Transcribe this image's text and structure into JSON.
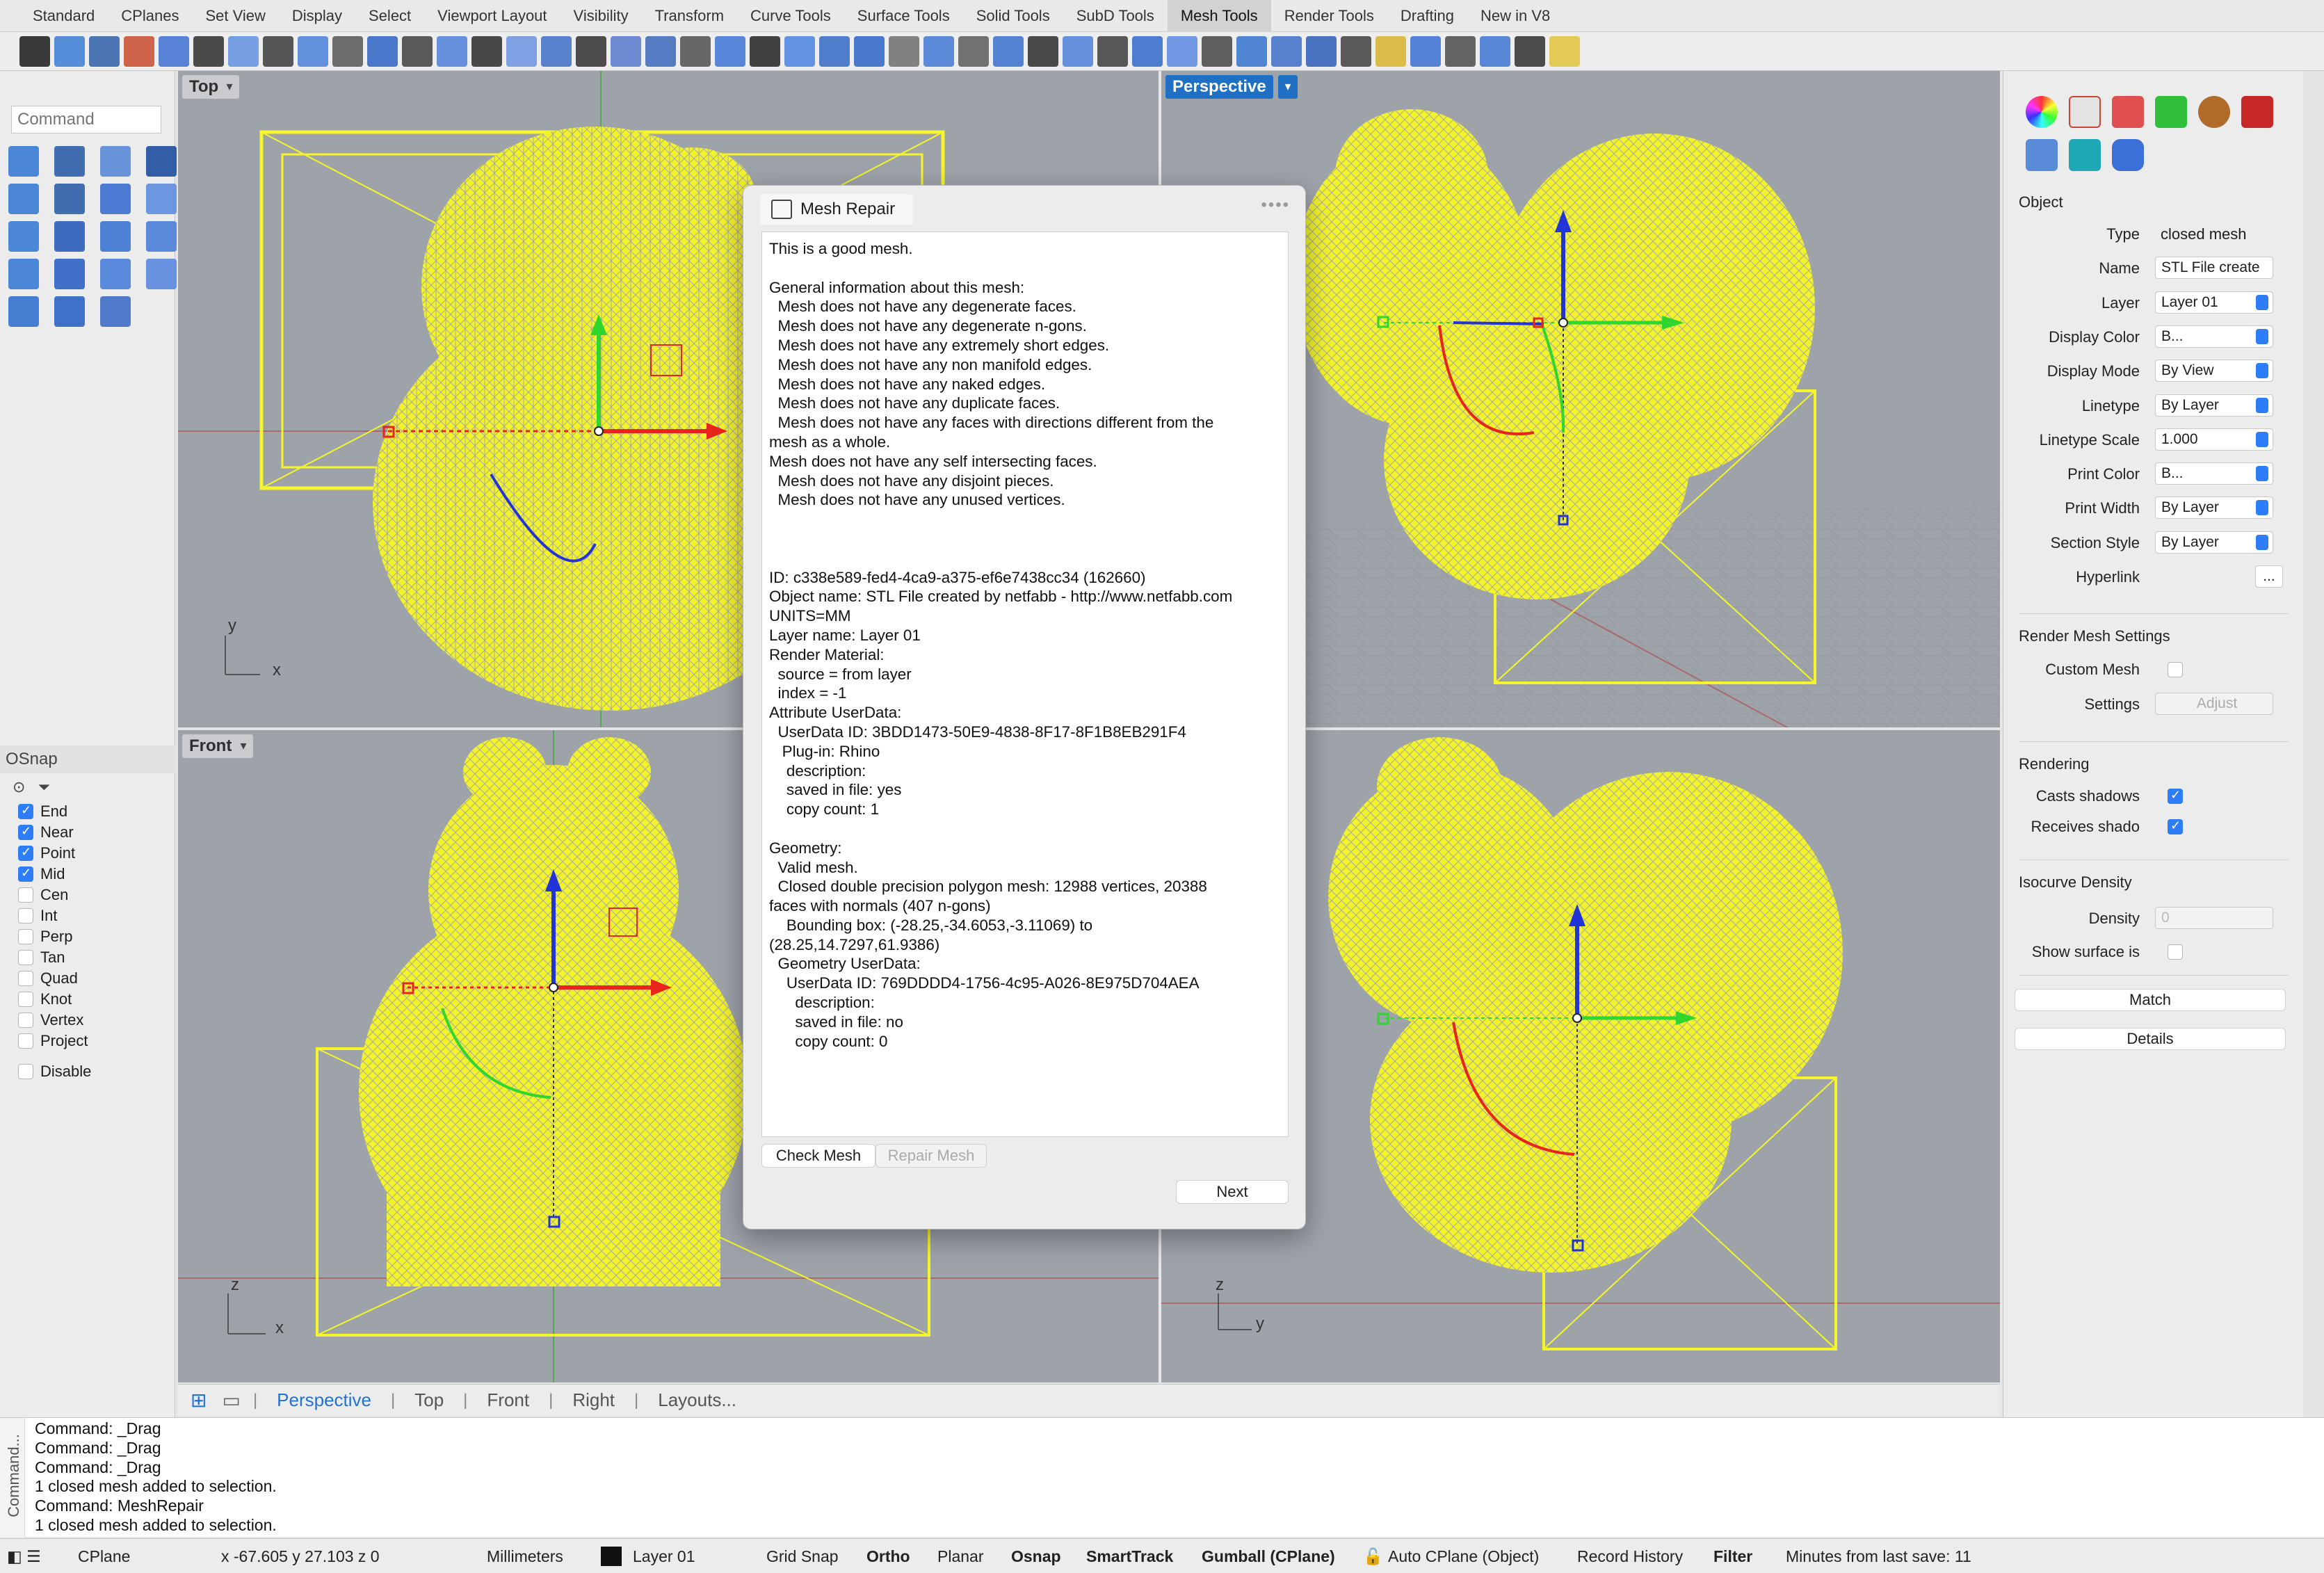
{
  "tabs": [
    "Standard",
    "CPlanes",
    "Set View",
    "Display",
    "Select",
    "Viewport Layout",
    "Visibility",
    "Transform",
    "Curve Tools",
    "Surface Tools",
    "Solid Tools",
    "SubD Tools",
    "Mesh Tools",
    "Render Tools",
    "Drafting",
    "New in V8"
  ],
  "active_tab": "Mesh Tools",
  "command_placeholder": "Command",
  "osnap": {
    "title": "OSnap",
    "items": [
      {
        "label": "End",
        "checked": true
      },
      {
        "label": "Near",
        "checked": true
      },
      {
        "label": "Point",
        "checked": true
      },
      {
        "label": "Mid",
        "checked": true
      },
      {
        "label": "Cen",
        "checked": false
      },
      {
        "label": "Int",
        "checked": false
      },
      {
        "label": "Perp",
        "checked": false
      },
      {
        "label": "Tan",
        "checked": false
      },
      {
        "label": "Quad",
        "checked": false
      },
      {
        "label": "Knot",
        "checked": false
      },
      {
        "label": "Vertex",
        "checked": false
      },
      {
        "label": "Project",
        "checked": false
      }
    ],
    "disable_label": "Disable"
  },
  "viewports": {
    "top": {
      "title": "Top",
      "axes": [
        "y",
        "x"
      ]
    },
    "perspective": {
      "title": "Perspective"
    },
    "front": {
      "title": "Front",
      "axes": [
        "z",
        "x"
      ]
    },
    "right": {
      "axes": [
        "z",
        "y"
      ]
    }
  },
  "viewport_tabs": [
    "Perspective",
    "Top",
    "Front",
    "Right",
    "Layouts..."
  ],
  "active_viewport_tab": "Perspective",
  "dialog": {
    "title": "Mesh Repair",
    "lines": [
      "This is a good mesh.",
      "",
      "General information about this mesh:",
      "  Mesh does not have any degenerate faces.",
      "  Mesh does not have any degenerate n-gons.",
      "  Mesh does not have any extremely short edges.",
      "  Mesh does not have any non manifold edges.",
      "  Mesh does not have any naked edges.",
      "  Mesh does not have any duplicate faces.",
      "  Mesh does not have any faces with directions different from the",
      "mesh as a whole.",
      "Mesh does not have any self intersecting faces.",
      "  Mesh does not have any disjoint pieces.",
      "  Mesh does not have any unused vertices.",
      "",
      "",
      "",
      "ID: c338e589-fed4-4ca9-a375-ef6e7438cc34 (162660)",
      "Object name: STL File created by netfabb - http://www.netfabb.com",
      "UNITS=MM",
      "Layer name: Layer 01",
      "Render Material:",
      "  source = from layer",
      "  index = -1",
      "Attribute UserData:",
      "  UserData ID: 3BDD1473-50E9-4838-8F17-8F1B8EB291F4",
      "   Plug-in: Rhino",
      "    description:",
      "    saved in file: yes",
      "    copy count: 1",
      "",
      "Geometry:",
      "  Valid mesh.",
      "  Closed double precision polygon mesh: 12988 vertices, 20388",
      "faces with normals (407 n-gons)",
      "    Bounding box: (-28.25,-34.6053,-3.11069) to",
      "(28.25,14.7297,61.9386)",
      "  Geometry UserData:",
      "    UserData ID: 769DDDD4-1756-4c95-A026-8E975D704AEA",
      "      description:",
      "      saved in file: no",
      "      copy count: 0"
    ],
    "check_mesh": "Check Mesh",
    "repair_mesh": "Repair Mesh",
    "next": "Next"
  },
  "properties": {
    "section_object": "Object",
    "rows": [
      {
        "label": "Type",
        "value": "closed mesh",
        "kind": "plain"
      },
      {
        "label": "Name",
        "value": "STL File create",
        "kind": "field"
      },
      {
        "label": "Layer",
        "value": "Layer 01",
        "kind": "select"
      },
      {
        "label": "Display Color",
        "value": "B...",
        "kind": "select"
      },
      {
        "label": "Display Mode",
        "value": "By View",
        "kind": "select"
      },
      {
        "label": "Linetype",
        "value": "By Layer",
        "kind": "select"
      },
      {
        "label": "Linetype Scale",
        "value": "1.000",
        "kind": "spin"
      },
      {
        "label": "Print Color",
        "value": "B...",
        "kind": "select"
      },
      {
        "label": "Print Width",
        "value": "By Layer",
        "kind": "select"
      },
      {
        "label": "Section Style",
        "value": "By Layer",
        "kind": "select"
      },
      {
        "label": "Hyperlink",
        "value": "...",
        "kind": "button"
      }
    ],
    "render_mesh_settings": "Render Mesh Settings",
    "custom_mesh": "Custom Mesh",
    "settings": "Settings",
    "adjust": "Adjust",
    "rendering": "Rendering",
    "casts_shadows": "Casts shadows",
    "receives_shadows": "Receives shado",
    "isocurve_density": "Isocurve Density",
    "density": "Density",
    "density_value": "0",
    "show_surface": "Show surface is",
    "match": "Match",
    "details": "Details"
  },
  "command_history": [
    "Command: _Drag",
    "Command: _Drag",
    "Command: _Drag",
    "1 closed mesh added to selection.",
    "Command: MeshRepair",
    "1 closed mesh added to selection."
  ],
  "command_side_label": "Command...",
  "status": {
    "cplane": "CPlane",
    "coords": "x -67.605  y 27.103  z 0",
    "units": "Millimeters",
    "layer": "Layer 01",
    "grid_snap": "Grid Snap",
    "ortho": "Ortho",
    "planar": "Planar",
    "osnap": "Osnap",
    "smarttrack": "SmartTrack",
    "gumball": "Gumball (CPlane)",
    "auto_cplane": "Auto CPlane (Object)",
    "record_history": "Record History",
    "filter": "Filter",
    "last_save": "Minutes from last save: 11"
  },
  "colors": {
    "wire": "#f5f52a",
    "viewport_bg": "#9ea3aa",
    "accent": "#1f6fc4",
    "axis_red": "#e8241c",
    "axis_green": "#2ed62e",
    "axis_blue": "#2233d8"
  }
}
